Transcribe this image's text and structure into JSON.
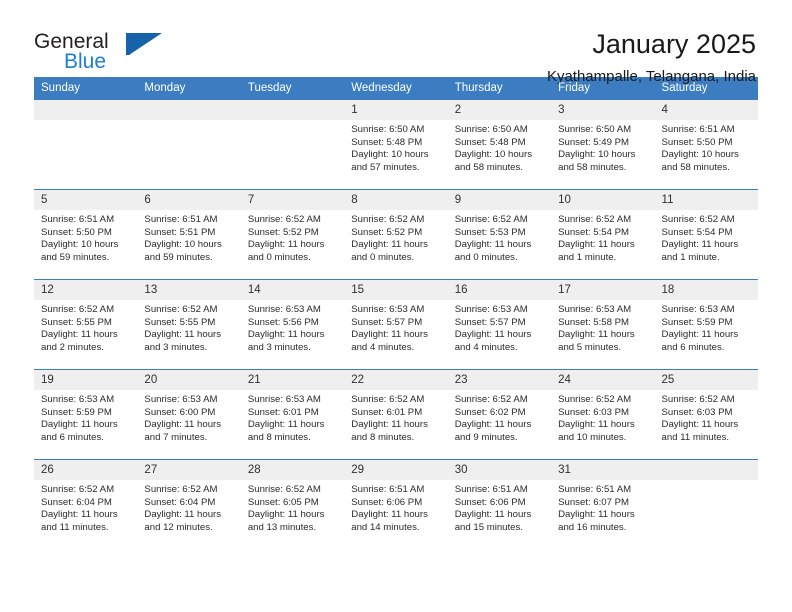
{
  "brand": {
    "line1": "General",
    "line2": "Blue",
    "logo_icon": "blue-triangle-logo"
  },
  "header": {
    "title": "January 2025",
    "subtitle": "Kyathampalle, Telangana, India"
  },
  "calendar": {
    "weekday_headers": [
      "Sunday",
      "Monday",
      "Tuesday",
      "Wednesday",
      "Thursday",
      "Friday",
      "Saturday"
    ],
    "accent_color": "#3b7dc0",
    "daynum_bg": "#efefef",
    "weeks": [
      [
        {
          "day": "",
          "sunrise": "",
          "sunset": "",
          "daylight_1": "",
          "daylight_2": ""
        },
        {
          "day": "",
          "sunrise": "",
          "sunset": "",
          "daylight_1": "",
          "daylight_2": ""
        },
        {
          "day": "",
          "sunrise": "",
          "sunset": "",
          "daylight_1": "",
          "daylight_2": ""
        },
        {
          "day": "1",
          "sunrise": "Sunrise: 6:50 AM",
          "sunset": "Sunset: 5:48 PM",
          "daylight_1": "Daylight: 10 hours",
          "daylight_2": "and 57 minutes."
        },
        {
          "day": "2",
          "sunrise": "Sunrise: 6:50 AM",
          "sunset": "Sunset: 5:48 PM",
          "daylight_1": "Daylight: 10 hours",
          "daylight_2": "and 58 minutes."
        },
        {
          "day": "3",
          "sunrise": "Sunrise: 6:50 AM",
          "sunset": "Sunset: 5:49 PM",
          "daylight_1": "Daylight: 10 hours",
          "daylight_2": "and 58 minutes."
        },
        {
          "day": "4",
          "sunrise": "Sunrise: 6:51 AM",
          "sunset": "Sunset: 5:50 PM",
          "daylight_1": "Daylight: 10 hours",
          "daylight_2": "and 58 minutes."
        }
      ],
      [
        {
          "day": "5",
          "sunrise": "Sunrise: 6:51 AM",
          "sunset": "Sunset: 5:50 PM",
          "daylight_1": "Daylight: 10 hours",
          "daylight_2": "and 59 minutes."
        },
        {
          "day": "6",
          "sunrise": "Sunrise: 6:51 AM",
          "sunset": "Sunset: 5:51 PM",
          "daylight_1": "Daylight: 10 hours",
          "daylight_2": "and 59 minutes."
        },
        {
          "day": "7",
          "sunrise": "Sunrise: 6:52 AM",
          "sunset": "Sunset: 5:52 PM",
          "daylight_1": "Daylight: 11 hours",
          "daylight_2": "and 0 minutes."
        },
        {
          "day": "8",
          "sunrise": "Sunrise: 6:52 AM",
          "sunset": "Sunset: 5:52 PM",
          "daylight_1": "Daylight: 11 hours",
          "daylight_2": "and 0 minutes."
        },
        {
          "day": "9",
          "sunrise": "Sunrise: 6:52 AM",
          "sunset": "Sunset: 5:53 PM",
          "daylight_1": "Daylight: 11 hours",
          "daylight_2": "and 0 minutes."
        },
        {
          "day": "10",
          "sunrise": "Sunrise: 6:52 AM",
          "sunset": "Sunset: 5:54 PM",
          "daylight_1": "Daylight: 11 hours",
          "daylight_2": "and 1 minute."
        },
        {
          "day": "11",
          "sunrise": "Sunrise: 6:52 AM",
          "sunset": "Sunset: 5:54 PM",
          "daylight_1": "Daylight: 11 hours",
          "daylight_2": "and 1 minute."
        }
      ],
      [
        {
          "day": "12",
          "sunrise": "Sunrise: 6:52 AM",
          "sunset": "Sunset: 5:55 PM",
          "daylight_1": "Daylight: 11 hours",
          "daylight_2": "and 2 minutes."
        },
        {
          "day": "13",
          "sunrise": "Sunrise: 6:52 AM",
          "sunset": "Sunset: 5:55 PM",
          "daylight_1": "Daylight: 11 hours",
          "daylight_2": "and 3 minutes."
        },
        {
          "day": "14",
          "sunrise": "Sunrise: 6:53 AM",
          "sunset": "Sunset: 5:56 PM",
          "daylight_1": "Daylight: 11 hours",
          "daylight_2": "and 3 minutes."
        },
        {
          "day": "15",
          "sunrise": "Sunrise: 6:53 AM",
          "sunset": "Sunset: 5:57 PM",
          "daylight_1": "Daylight: 11 hours",
          "daylight_2": "and 4 minutes."
        },
        {
          "day": "16",
          "sunrise": "Sunrise: 6:53 AM",
          "sunset": "Sunset: 5:57 PM",
          "daylight_1": "Daylight: 11 hours",
          "daylight_2": "and 4 minutes."
        },
        {
          "day": "17",
          "sunrise": "Sunrise: 6:53 AM",
          "sunset": "Sunset: 5:58 PM",
          "daylight_1": "Daylight: 11 hours",
          "daylight_2": "and 5 minutes."
        },
        {
          "day": "18",
          "sunrise": "Sunrise: 6:53 AM",
          "sunset": "Sunset: 5:59 PM",
          "daylight_1": "Daylight: 11 hours",
          "daylight_2": "and 6 minutes."
        }
      ],
      [
        {
          "day": "19",
          "sunrise": "Sunrise: 6:53 AM",
          "sunset": "Sunset: 5:59 PM",
          "daylight_1": "Daylight: 11 hours",
          "daylight_2": "and 6 minutes."
        },
        {
          "day": "20",
          "sunrise": "Sunrise: 6:53 AM",
          "sunset": "Sunset: 6:00 PM",
          "daylight_1": "Daylight: 11 hours",
          "daylight_2": "and 7 minutes."
        },
        {
          "day": "21",
          "sunrise": "Sunrise: 6:53 AM",
          "sunset": "Sunset: 6:01 PM",
          "daylight_1": "Daylight: 11 hours",
          "daylight_2": "and 8 minutes."
        },
        {
          "day": "22",
          "sunrise": "Sunrise: 6:52 AM",
          "sunset": "Sunset: 6:01 PM",
          "daylight_1": "Daylight: 11 hours",
          "daylight_2": "and 8 minutes."
        },
        {
          "day": "23",
          "sunrise": "Sunrise: 6:52 AM",
          "sunset": "Sunset: 6:02 PM",
          "daylight_1": "Daylight: 11 hours",
          "daylight_2": "and 9 minutes."
        },
        {
          "day": "24",
          "sunrise": "Sunrise: 6:52 AM",
          "sunset": "Sunset: 6:03 PM",
          "daylight_1": "Daylight: 11 hours",
          "daylight_2": "and 10 minutes."
        },
        {
          "day": "25",
          "sunrise": "Sunrise: 6:52 AM",
          "sunset": "Sunset: 6:03 PM",
          "daylight_1": "Daylight: 11 hours",
          "daylight_2": "and 11 minutes."
        }
      ],
      [
        {
          "day": "26",
          "sunrise": "Sunrise: 6:52 AM",
          "sunset": "Sunset: 6:04 PM",
          "daylight_1": "Daylight: 11 hours",
          "daylight_2": "and 11 minutes."
        },
        {
          "day": "27",
          "sunrise": "Sunrise: 6:52 AM",
          "sunset": "Sunset: 6:04 PM",
          "daylight_1": "Daylight: 11 hours",
          "daylight_2": "and 12 minutes."
        },
        {
          "day": "28",
          "sunrise": "Sunrise: 6:52 AM",
          "sunset": "Sunset: 6:05 PM",
          "daylight_1": "Daylight: 11 hours",
          "daylight_2": "and 13 minutes."
        },
        {
          "day": "29",
          "sunrise": "Sunrise: 6:51 AM",
          "sunset": "Sunset: 6:06 PM",
          "daylight_1": "Daylight: 11 hours",
          "daylight_2": "and 14 minutes."
        },
        {
          "day": "30",
          "sunrise": "Sunrise: 6:51 AM",
          "sunset": "Sunset: 6:06 PM",
          "daylight_1": "Daylight: 11 hours",
          "daylight_2": "and 15 minutes."
        },
        {
          "day": "31",
          "sunrise": "Sunrise: 6:51 AM",
          "sunset": "Sunset: 6:07 PM",
          "daylight_1": "Daylight: 11 hours",
          "daylight_2": "and 16 minutes."
        },
        {
          "day": "",
          "sunrise": "",
          "sunset": "",
          "daylight_1": "",
          "daylight_2": ""
        }
      ]
    ]
  }
}
